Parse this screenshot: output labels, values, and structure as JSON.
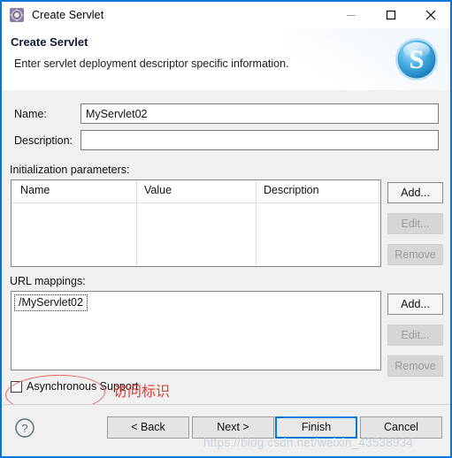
{
  "window": {
    "title": "Create Servlet",
    "icon": "servlet-gear-icon",
    "accent_color": "#0078d7",
    "controls": {
      "minimize": "minimize-icon",
      "maximize": "maximize-icon",
      "close": "close-icon"
    }
  },
  "header": {
    "title": "Create Servlet",
    "description": "Enter servlet deployment descriptor specific information.",
    "logo": "spring-s-sphere-logo"
  },
  "form": {
    "name_label": "Name:",
    "name_value": "MyServlet02",
    "name_placeholder": "",
    "description_label": "Description:",
    "description_value": "",
    "description_placeholder": ""
  },
  "init_params": {
    "section_label": "Initialization parameters:",
    "columns": [
      "Name",
      "Value",
      "Description"
    ],
    "rows": [],
    "buttons": [
      {
        "label": "Add...",
        "enabled": true
      },
      {
        "label": "Edit...",
        "enabled": false
      },
      {
        "label": "Remove",
        "enabled": false
      }
    ]
  },
  "url_mappings": {
    "section_label": "URL mappings:",
    "items": [
      "/MyServlet02"
    ],
    "buttons": [
      {
        "label": "Add...",
        "enabled": true
      },
      {
        "label": "Edit...",
        "enabled": false
      },
      {
        "label": "Remove",
        "enabled": false
      }
    ]
  },
  "async": {
    "label": "Asynchronous Support",
    "checked": false
  },
  "footer": {
    "help_icon": "help-question-icon",
    "buttons": {
      "back": "< Back",
      "next": "Next >",
      "finish": "Finish",
      "cancel": "Cancel"
    },
    "focused_button": "Finish"
  },
  "annotations": {
    "highlight_text": "访问标识",
    "highlight_color": "#e03a30",
    "watermark": "https://blog.csdn.net/weixin_43538934"
  }
}
